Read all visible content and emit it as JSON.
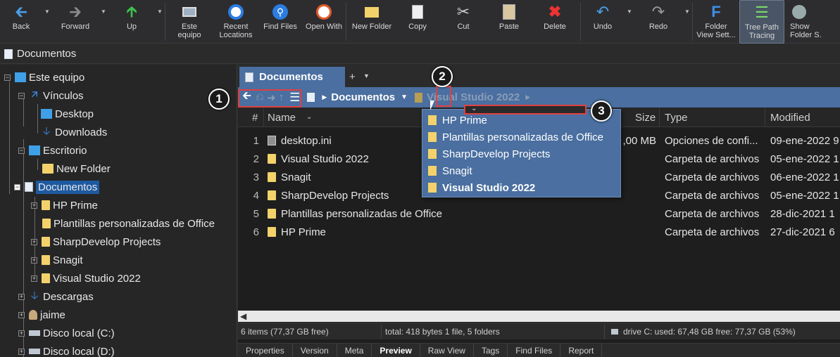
{
  "toolbar": {
    "buttons": [
      {
        "label": "Back"
      },
      {
        "label": "Forward"
      },
      {
        "label": "Up"
      },
      {
        "label": "Este\nequipo"
      },
      {
        "label": "Recent\nLocations"
      },
      {
        "label": "Find Files"
      },
      {
        "label": "Open With"
      },
      {
        "label": "New Folder"
      },
      {
        "label": "Copy"
      },
      {
        "label": "Cut"
      },
      {
        "label": "Paste"
      },
      {
        "label": "Delete"
      },
      {
        "label": "Undo"
      },
      {
        "label": "Redo"
      },
      {
        "label": "Folder\nView Sett..."
      },
      {
        "label": "Tree Path\nTracing"
      },
      {
        "label": "Show\nFolder S..."
      }
    ]
  },
  "addressbar": {
    "path": "Documentos"
  },
  "tree": {
    "items": [
      {
        "label": "Este equipo"
      },
      {
        "label": "Vínculos"
      },
      {
        "label": "Desktop"
      },
      {
        "label": "Downloads"
      },
      {
        "label": "Escritorio"
      },
      {
        "label": "New Folder"
      },
      {
        "label": "Documentos"
      },
      {
        "label": "HP Prime"
      },
      {
        "label": "Plantillas personalizadas de Office"
      },
      {
        "label": "SharpDevelop Projects"
      },
      {
        "label": "Snagit"
      },
      {
        "label": "Visual Studio 2022"
      },
      {
        "label": "Descargas"
      },
      {
        "label": "jaime"
      },
      {
        "label": "Disco local (C:)"
      },
      {
        "label": "Disco local (D:)"
      }
    ]
  },
  "tabs": {
    "active": "Documentos",
    "plus": "+"
  },
  "breadcrumb": {
    "current": "Documentos",
    "next": "Visual Studio 2022"
  },
  "annotations": [
    "1",
    "2",
    "3"
  ],
  "columns": {
    "num": "#",
    "name": "Name",
    "size": "Size",
    "type": "Type",
    "modified": "Modified"
  },
  "files": [
    {
      "num": "1",
      "name": "desktop.ini",
      "size": ",00 MB",
      "type": "Opciones de confi...",
      "modified": "09-ene-2022 9"
    },
    {
      "num": "2",
      "name": "Visual Studio 2022",
      "size": "",
      "type": "Carpeta de archivos",
      "modified": "05-ene-2022 1"
    },
    {
      "num": "3",
      "name": "Snagit",
      "size": "",
      "type": "Carpeta de archivos",
      "modified": "06-ene-2022 1"
    },
    {
      "num": "4",
      "name": "SharpDevelop Projects",
      "size": "",
      "type": "Carpeta de archivos",
      "modified": "05-ene-2022 1"
    },
    {
      "num": "5",
      "name": "Plantillas personalizadas de Office",
      "size": "",
      "type": "Carpeta de archivos",
      "modified": "28-dic-2021 1"
    },
    {
      "num": "6",
      "name": "HP Prime",
      "size": "",
      "type": "Carpeta de archivos",
      "modified": "27-dic-2021 6"
    }
  ],
  "dropdown": {
    "items": [
      {
        "label": "HP Prime"
      },
      {
        "label": "Plantillas personalizadas de Office"
      },
      {
        "label": "SharpDevelop Projects"
      },
      {
        "label": "Snagit"
      },
      {
        "label": "Visual Studio 2022"
      }
    ]
  },
  "status": {
    "items": "6 items (77,37 GB free)",
    "total": "total: 418 bytes  1 file, 5 folders",
    "drive": "drive C:  used: 67,48 GB  free: 77,37 GB (53%)"
  },
  "bottom_tabs": [
    "Properties",
    "Version",
    "Meta",
    "Preview",
    "Raw View",
    "Tags",
    "Find Files",
    "Report"
  ]
}
